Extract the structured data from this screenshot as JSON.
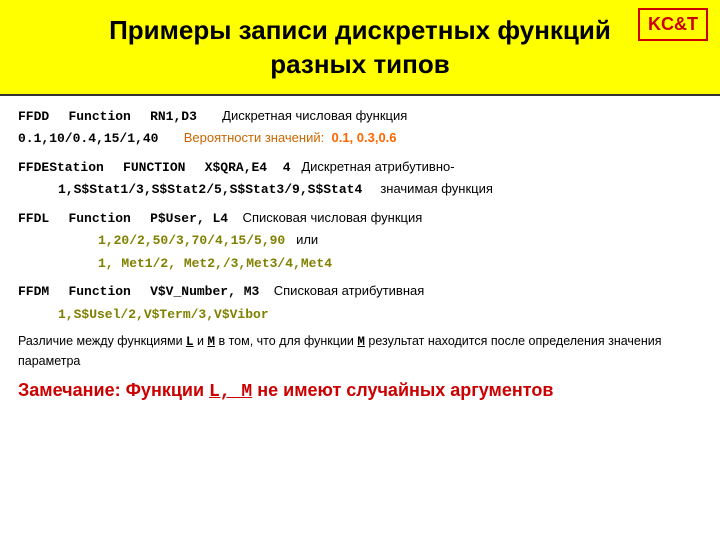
{
  "header": {
    "title_line1": "Примеры записи дискретных функций",
    "title_line2": "разных типов"
  },
  "logo": {
    "text": "KC&T"
  },
  "blocks": [
    {
      "id": "ffdd",
      "keyword": "FFDD",
      "func_keyword": "Function",
      "param": "RN1,D3",
      "desc": "Дискретная числовая функция",
      "line2_prefix": "0.1,10/0.4,15/1,40",
      "line2_prob_label": "Вероятности значений:",
      "line2_prob_values": "0.1, 0.3,0.6"
    },
    {
      "id": "ffde",
      "keyword": "FFDEStation",
      "func_keyword": "FUNCTION",
      "param": "X$QRA,E4",
      "count": "4",
      "desc": "Дискретная атрибутивно-",
      "line2": "1,S$Stat1/3,S$Stat2/5,S$Stat3/9,S$Stat4",
      "line2_suffix": "значимая функция"
    },
    {
      "id": "ffdl",
      "keyword": "FFDL",
      "func_keyword": "Function",
      "param": "P$User, L4",
      "desc": "Списковая числовая функция",
      "line2": "1,20/2,50/3,70/4,15/5,90",
      "line2_or": "или",
      "line3": "1, Met1/2, Met2,/3,Met3/4,Met4"
    },
    {
      "id": "ffdm",
      "keyword": "FFDM",
      "func_keyword": "Function",
      "param": "V$V_Number, M3",
      "desc": "Списковая атрибутивная",
      "line2": "1,S$Usel/2,V$Term/3,V$Vibor"
    }
  ],
  "remark": {
    "text": "Различие между функциями L и M в том, что для функции M результат находится после определения значения параметра",
    "highlight": "Замечание: Функции L, M не имеют случайных аргументов"
  }
}
